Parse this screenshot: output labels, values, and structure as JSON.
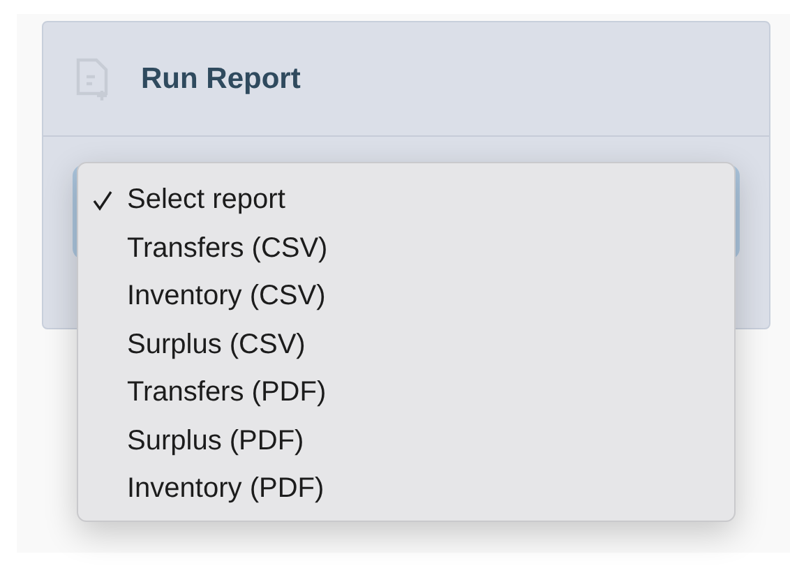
{
  "panel": {
    "title": "Run Report"
  },
  "report_menu": {
    "options": [
      {
        "label": "Select report",
        "selected": true
      },
      {
        "label": "Transfers (CSV)",
        "selected": false
      },
      {
        "label": "Inventory (CSV)",
        "selected": false
      },
      {
        "label": "Surplus (CSV)",
        "selected": false
      },
      {
        "label": "Transfers (PDF)",
        "selected": false
      },
      {
        "label": "Surplus (PDF)",
        "selected": false
      },
      {
        "label": "Inventory (PDF)",
        "selected": false
      }
    ]
  }
}
